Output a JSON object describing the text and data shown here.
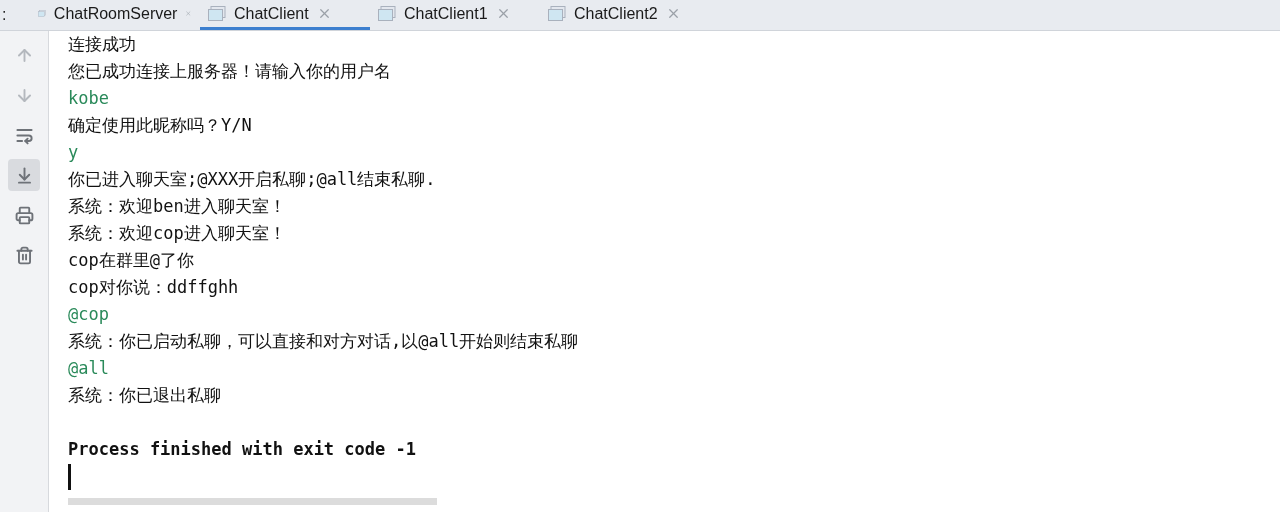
{
  "tab_bar": {
    "overflow_mark": ":",
    "tabs": [
      {
        "label": "ChatRoomServer",
        "selected": false
      },
      {
        "label": "ChatClient",
        "selected": true
      },
      {
        "label": "ChatClient1",
        "selected": false
      },
      {
        "label": "ChatClient2",
        "selected": false
      }
    ]
  },
  "gutter_buttons": [
    {
      "kind": "up",
      "selected": false
    },
    {
      "kind": "down",
      "selected": false
    },
    {
      "kind": "wrap",
      "selected": false
    },
    {
      "kind": "scroll_end",
      "selected": true
    },
    {
      "kind": "print",
      "selected": false
    },
    {
      "kind": "clear",
      "selected": false
    }
  ],
  "console_lines": [
    {
      "kind": "output",
      "text": "连接成功"
    },
    {
      "kind": "output",
      "text": "您已成功连接上服务器！请输入你的用户名"
    },
    {
      "kind": "input",
      "text": "kobe"
    },
    {
      "kind": "output",
      "text": "确定使用此昵称吗？Y/N"
    },
    {
      "kind": "input",
      "text": "y"
    },
    {
      "kind": "output",
      "text": "你已进入聊天室;@XXX开启私聊;@all结束私聊."
    },
    {
      "kind": "output",
      "text": "系统：欢迎ben进入聊天室！"
    },
    {
      "kind": "output",
      "text": "系统：欢迎cop进入聊天室！"
    },
    {
      "kind": "output",
      "text": "cop在群里@了你"
    },
    {
      "kind": "output",
      "text": "cop对你说：ddffghh"
    },
    {
      "kind": "input",
      "text": "@cop"
    },
    {
      "kind": "output",
      "text": "系统：你已启动私聊，可以直接和对方对话,以@all开始则结束私聊"
    },
    {
      "kind": "input",
      "text": "@all"
    },
    {
      "kind": "output",
      "text": "系统：你已退出私聊"
    },
    {
      "kind": "blank"
    },
    {
      "kind": "system",
      "text": "Process finished with exit code -1"
    }
  ]
}
